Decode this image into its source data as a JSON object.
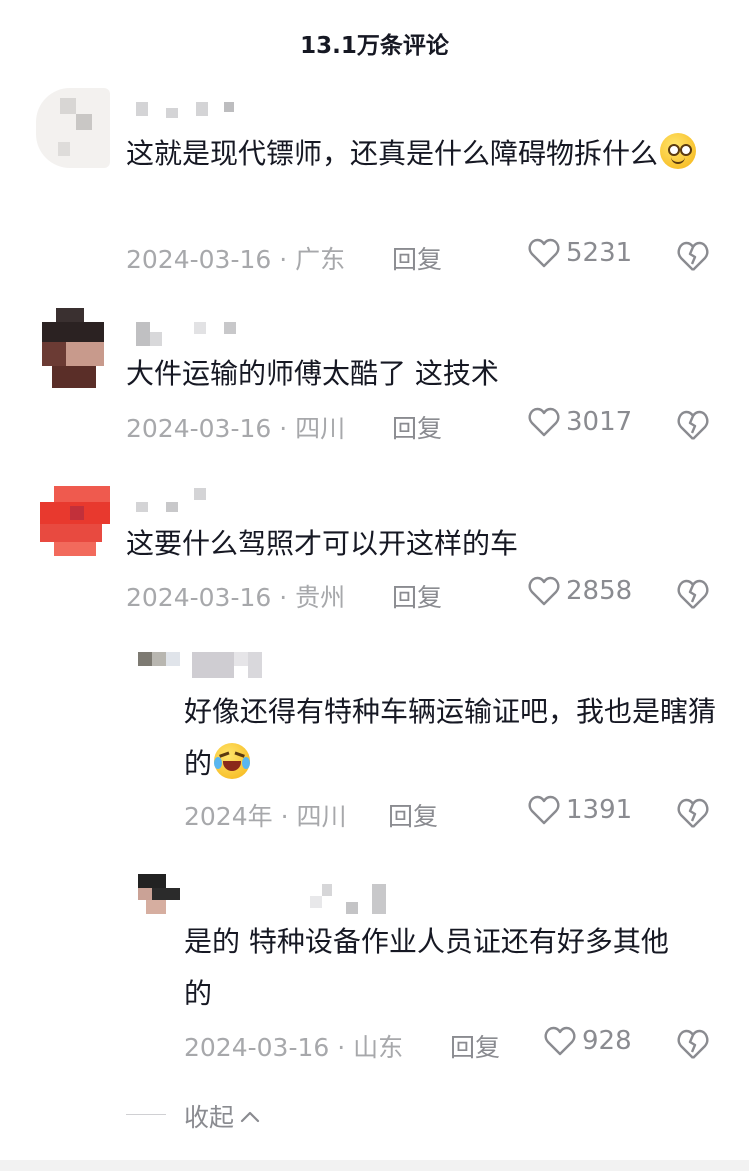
{
  "header": {
    "title": "13.1万条评论"
  },
  "comments": [
    {
      "text": "这就是现代镖师，还真是什么障碍物拆什么",
      "date": "2024-03-16 · 广东",
      "reply": "回复",
      "likes": "5231"
    },
    {
      "text": "大件运输的师傅太酷了 这技术",
      "date": "2024-03-16 · 四川",
      "reply": "回复",
      "likes": "3017"
    },
    {
      "text": "这要什么驾照才可以开这样的车",
      "date": "2024-03-16 · 贵州",
      "reply": "回复",
      "likes": "2858"
    },
    {
      "text": "好像还得有特种车辆运输证吧，我也是瞎猜的",
      "date": "2024年 · 四川",
      "reply": "回复",
      "likes": "1391"
    },
    {
      "text": "是的 特种设备作业人员证还有好多其他的",
      "date": "2024-03-16 · 山东",
      "reply": "回复",
      "likes": "928"
    }
  ],
  "collapse": {
    "label": "收起"
  },
  "colors": {
    "text": "#161823",
    "meta": "#a7a8ab",
    "icon": "#8a8b90"
  },
  "icons": {
    "like": "heart-icon",
    "dislike": "broken-heart-icon",
    "collapse": "chevron-up-icon"
  }
}
